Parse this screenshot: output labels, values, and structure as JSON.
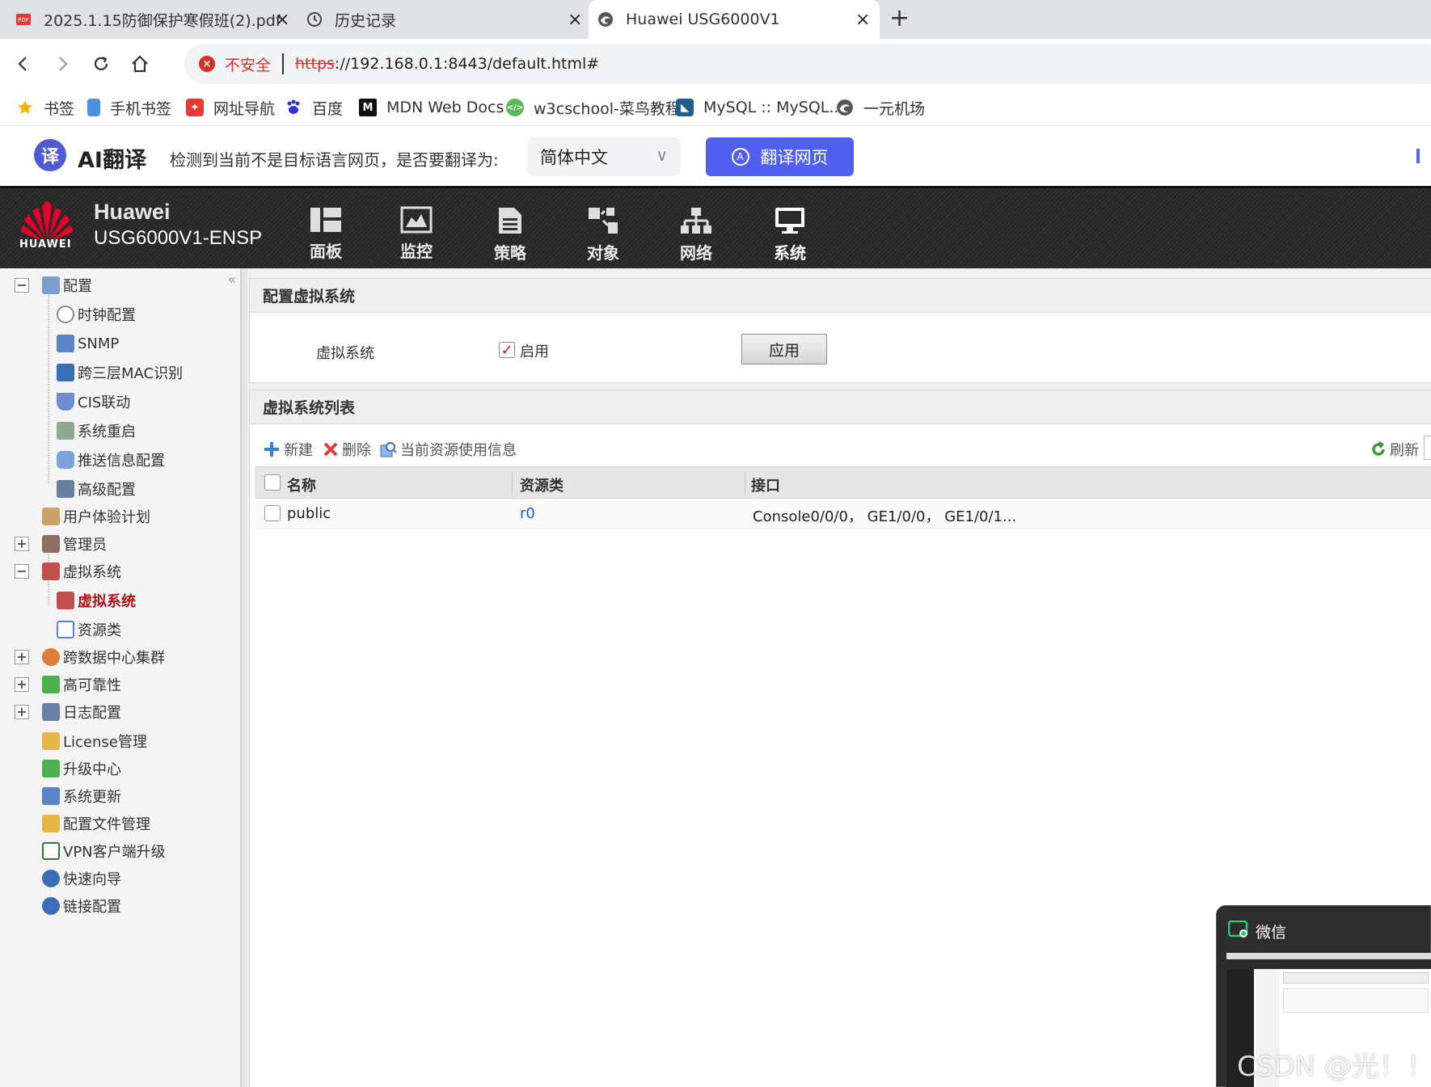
{
  "browser": {
    "tabs": [
      {
        "title": "2025.1.15防御保护寒假班(2).pdf",
        "icon": "pdf-icon"
      },
      {
        "title": "历史记录",
        "icon": "history-icon"
      },
      {
        "title": "Huawei USG6000V1",
        "icon": "edge-icon",
        "active": true
      }
    ],
    "new_tab": "+",
    "close_glyph": "×",
    "insecure_label": "不安全",
    "url_scheme": "https",
    "url_rest": "://192.168.0.1:8443/default.html#",
    "bookmarks": [
      {
        "label": "书签",
        "icon": "star-icon"
      },
      {
        "label": "手机书签",
        "icon": "phone-icon"
      },
      {
        "label": "网址导航",
        "icon": "nav-icon"
      },
      {
        "label": "百度",
        "icon": "baidu-icon"
      },
      {
        "label": "MDN Web Docs",
        "icon": "mdn-icon"
      },
      {
        "label": "w3cschool-菜鸟教程",
        "icon": "runoob-icon"
      },
      {
        "label": "MySQL :: MySQL...",
        "icon": "mysql-icon"
      },
      {
        "label": "一元机场",
        "icon": "edge-icon"
      }
    ]
  },
  "translate": {
    "logo_char": "译",
    "title": "AI翻译",
    "prompt": "检测到当前不是目标语言网页，是否要翻译为:",
    "language": "简体中文",
    "button": "翻译网页"
  },
  "header": {
    "logo_text": "HUAWEI",
    "brand": "Huawei",
    "model": "USG6000V1-ENSP",
    "nav": [
      {
        "label": "面板",
        "icon": "dashboard-icon"
      },
      {
        "label": "监控",
        "icon": "monitor-icon"
      },
      {
        "label": "策略",
        "icon": "policy-icon"
      },
      {
        "label": "对象",
        "icon": "object-icon"
      },
      {
        "label": "网络",
        "icon": "network-icon"
      },
      {
        "label": "系统",
        "icon": "system-icon",
        "active": true
      }
    ]
  },
  "sidebar": {
    "items": [
      {
        "label": "配置",
        "toggle": "−"
      },
      {
        "label": "时钟配置"
      },
      {
        "label": "SNMP"
      },
      {
        "label": "跨三层MAC识别"
      },
      {
        "label": "CIS联动"
      },
      {
        "label": "系统重启"
      },
      {
        "label": "推送信息配置"
      },
      {
        "label": "高级配置"
      },
      {
        "label": "用户体验计划"
      },
      {
        "label": "管理员",
        "toggle": "+"
      },
      {
        "label": "虚拟系统",
        "toggle": "−"
      },
      {
        "label": "虚拟系统",
        "active": true
      },
      {
        "label": "资源类"
      },
      {
        "label": "跨数据中心集群",
        "toggle": "+"
      },
      {
        "label": "高可靠性",
        "toggle": "+"
      },
      {
        "label": "日志配置",
        "toggle": "+"
      },
      {
        "label": "License管理"
      },
      {
        "label": "升级中心"
      },
      {
        "label": "系统更新"
      },
      {
        "label": "配置文件管理"
      },
      {
        "label": "VPN客户端升级"
      },
      {
        "label": "快速向导"
      },
      {
        "label": "链接配置"
      }
    ]
  },
  "config_panel": {
    "title": "配置虚拟系统",
    "field_label": "虚拟系统",
    "checkbox_checked": true,
    "checkbox_label": "启用",
    "apply": "应用"
  },
  "list_panel": {
    "title": "虚拟系统列表",
    "toolbar": {
      "new": "新建",
      "delete": "删除",
      "usage": "当前资源使用信息",
      "refresh": "刷新"
    },
    "columns": [
      "名称",
      "资源类",
      "接口"
    ],
    "rows": [
      {
        "name": "public",
        "resource": "r0",
        "interfaces": "Console0/0/0， GE1/0/0， GE1/0/1..."
      }
    ]
  },
  "wechat": {
    "title": "微信"
  },
  "watermark": "CSDN @光！！"
}
